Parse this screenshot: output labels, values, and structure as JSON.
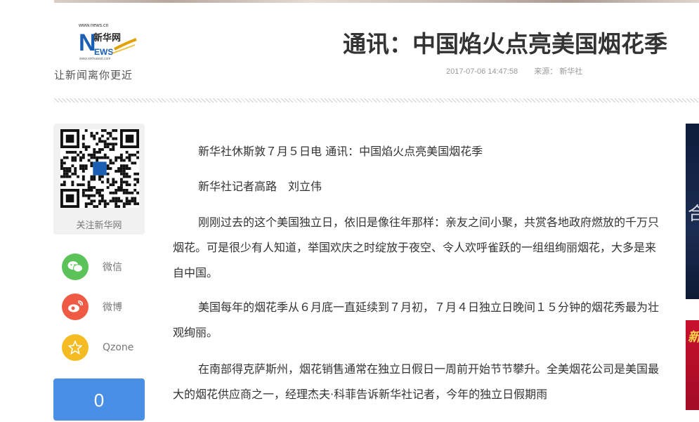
{
  "header": {
    "logo": {
      "url_text": "www.news.cn",
      "cn_text": "新华网",
      "wordmark": "NEWS",
      "sub_url": "www.xinhuanet.com",
      "tagline": "让新闻离你更近"
    },
    "headline": "通讯：中国焰火点亮美国烟花季",
    "timestamp": "2017-07-06 14:47:58",
    "source": "来源： 新华社"
  },
  "sidebar": {
    "qr_label": "关注新华网",
    "share": [
      {
        "label": "微信",
        "icon": "wechat-icon",
        "color": "#5cc25a"
      },
      {
        "label": "微博",
        "icon": "weibo-icon",
        "color": "#ee5a43"
      },
      {
        "label": "Qzone",
        "icon": "qzone-icon",
        "color": "#f5bb22"
      }
    ],
    "like_count": "0"
  },
  "article": {
    "paragraphs": [
      "新华社休斯敦７月５日电  通讯：中国焰火点亮美国烟花季",
      "新华社记者高路　刘立伟",
      "刚刚过去的这个美国独立日，依旧是像往年那样：亲友之间小聚，共赏各地政府燃放的千万只烟花。可是很少有人知道，举国欢庆之时绽放于夜空、令人欢呼雀跃的一组组绚丽烟花，大多是来自中国。",
      "美国每年的烟花季从６月底一直延续到７月初，７月４日独立日晚间１５分钟的烟花秀最为壮观绚丽。",
      "在南部得克萨斯州，烟花销售通常在独立日假日一周前开始节节攀升。全美烟花公司是美国最大的烟花供应商之一，经理杰夫·科菲告诉新华社记者，今年的独立日假期雨"
    ]
  },
  "ads": {
    "ad1_glyph": "合",
    "ad2_glyph": "新"
  }
}
